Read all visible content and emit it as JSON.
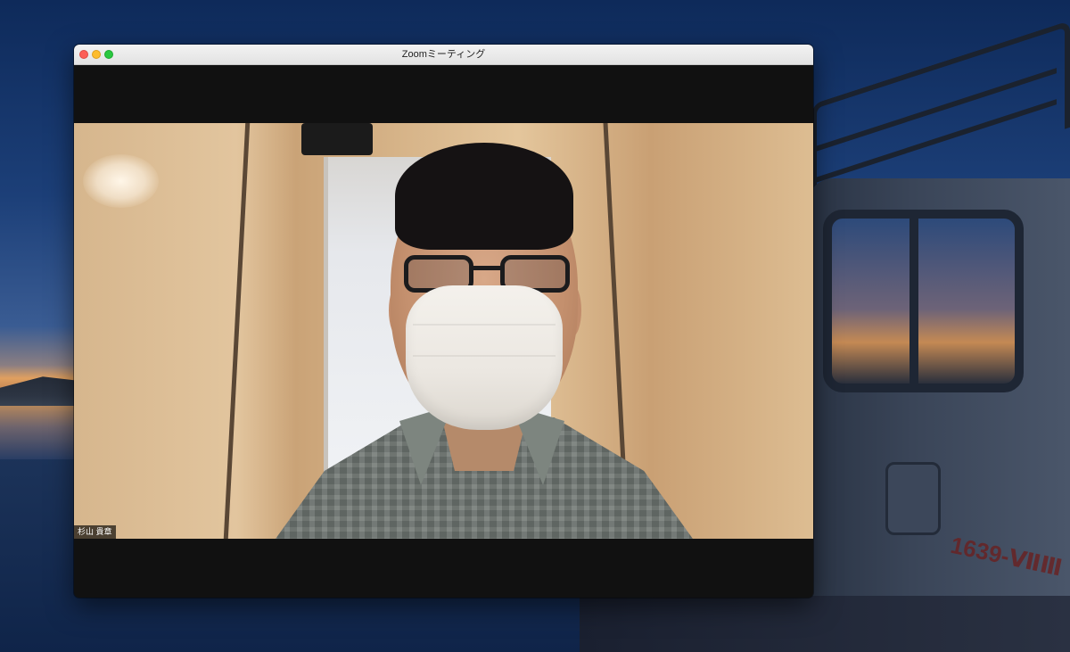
{
  "window": {
    "title": "Zoomミーティング",
    "controls": {
      "close_color": "#fc5f57",
      "minimize_color": "#fdbc2e",
      "maximize_color": "#2ac840"
    }
  },
  "meeting": {
    "participant_name": "杉山 貴章"
  },
  "desktop": {
    "truck_plate_text": "1639-ⅦⅢ"
  },
  "icons": [
    "window-close-icon",
    "window-minimize-icon",
    "window-maximize-icon"
  ]
}
